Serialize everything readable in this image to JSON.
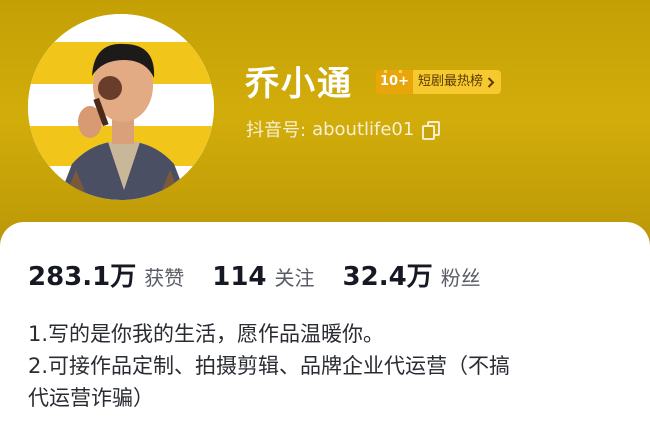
{
  "profile": {
    "name": "乔小通",
    "rank_number": "10+",
    "rank_label": "短剧最热榜",
    "douyin_id_label": "抖音号:",
    "douyin_id": "aboutlife01"
  },
  "stats": {
    "likes_value": "283.1万",
    "likes_label": "获赞",
    "following_value": "114",
    "following_label": "关注",
    "followers_value": "32.4万",
    "followers_label": "粉丝"
  },
  "bio": {
    "line1": "1.写的是你我的生活，愿作品温暖你。",
    "line2": "2.可接作品定制、拍摄剪辑、品牌企业代运营（不搞",
    "line3": "代运营诈骗）"
  },
  "icons": {
    "rank_arrow": "chevron-right-icon",
    "copy": "copy-icon"
  },
  "colors": {
    "header": "#c4a006",
    "badge_dark": "#e9a60a",
    "badge_light": "#f6ca2f",
    "card": "#ffffff"
  }
}
